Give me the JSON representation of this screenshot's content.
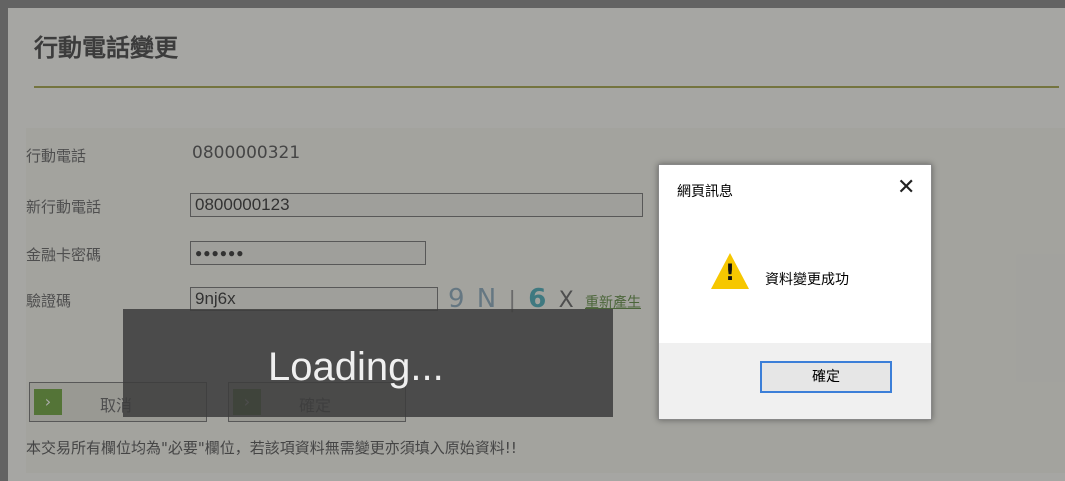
{
  "page": {
    "title": "行動電話變更",
    "note": "本交易所有欄位均為\"必要\"欄位，若該項資料無需變更亦須填入原始資料!!"
  },
  "form": {
    "mobile_label": "行動電話",
    "mobile_value": "0800000321",
    "new_mobile_label": "新行動電話",
    "new_mobile_value": "0800000123",
    "pin_label": "金融卡密碼",
    "pin_value": "●●●●●●",
    "captcha_label": "驗證碼",
    "captcha_input_value": "9nj6x",
    "captcha_image": {
      "part1": "9 N",
      "bar": "|",
      "part2": "6",
      "part3": "X"
    },
    "regenerate_link": "重新產生"
  },
  "buttons": {
    "cancel": "取消",
    "confirm": "確定",
    "arrow": "›"
  },
  "loading": {
    "text": "Loading..."
  },
  "dialog": {
    "title": "網頁訊息",
    "close": "✕",
    "message": "資料變更成功",
    "ok": "確定"
  }
}
